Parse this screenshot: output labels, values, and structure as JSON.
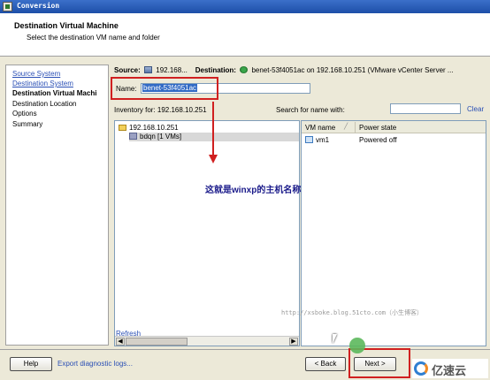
{
  "window": {
    "title": "Conversion"
  },
  "header": {
    "title": "Destination Virtual Machine",
    "subtitle": "Select the destination VM name and folder"
  },
  "nav": {
    "items": [
      {
        "label": "Source System",
        "state": "link"
      },
      {
        "label": "Destination System",
        "state": "link"
      },
      {
        "label": "Destination Virtual Machi",
        "state": "current"
      },
      {
        "label": "Destination Location",
        "state": "pending"
      },
      {
        "label": "Options",
        "state": "pending"
      },
      {
        "label": "Summary",
        "state": "pending"
      }
    ]
  },
  "source_bar": {
    "source_label": "Source:",
    "source_value": "192.168...",
    "destination_label": "Destination:",
    "destination_value": "benet-53f4051ac on 192.168.10.251 (VMware vCenter Server ..."
  },
  "name_field": {
    "label": "Name:",
    "value": "benet-53f4051ac"
  },
  "inventory": {
    "label": "Inventory for: 192.168.10.251",
    "tree": [
      {
        "label": "192.168.10.251",
        "icon": "folder-icon"
      },
      {
        "label": "bdqn [1 VMs]",
        "icon": "datacenter-icon",
        "selected": true
      }
    ]
  },
  "search": {
    "label": "Search for name with:",
    "value": "",
    "clear_label": "Clear"
  },
  "vm_table": {
    "columns": [
      "VM name",
      "Power state"
    ],
    "rows": [
      {
        "name": "vm1",
        "power": "Powered off"
      }
    ]
  },
  "refresh_label": "Refresh",
  "footer": {
    "help_label": "Help",
    "export_label": "Export diagnostic logs...",
    "back_label": "< Back",
    "next_label": "Next >"
  },
  "annotation": {
    "text": "这就是winxp的主机名称",
    "color": "#d02020"
  },
  "watermark": "http://xsboke.blog.51cto.com（小生博客）",
  "logo_text": "亿速云",
  "colors": {
    "title_bar": "#1d4fa8",
    "link": "#2a4fb5",
    "selection": "#316ac5"
  }
}
